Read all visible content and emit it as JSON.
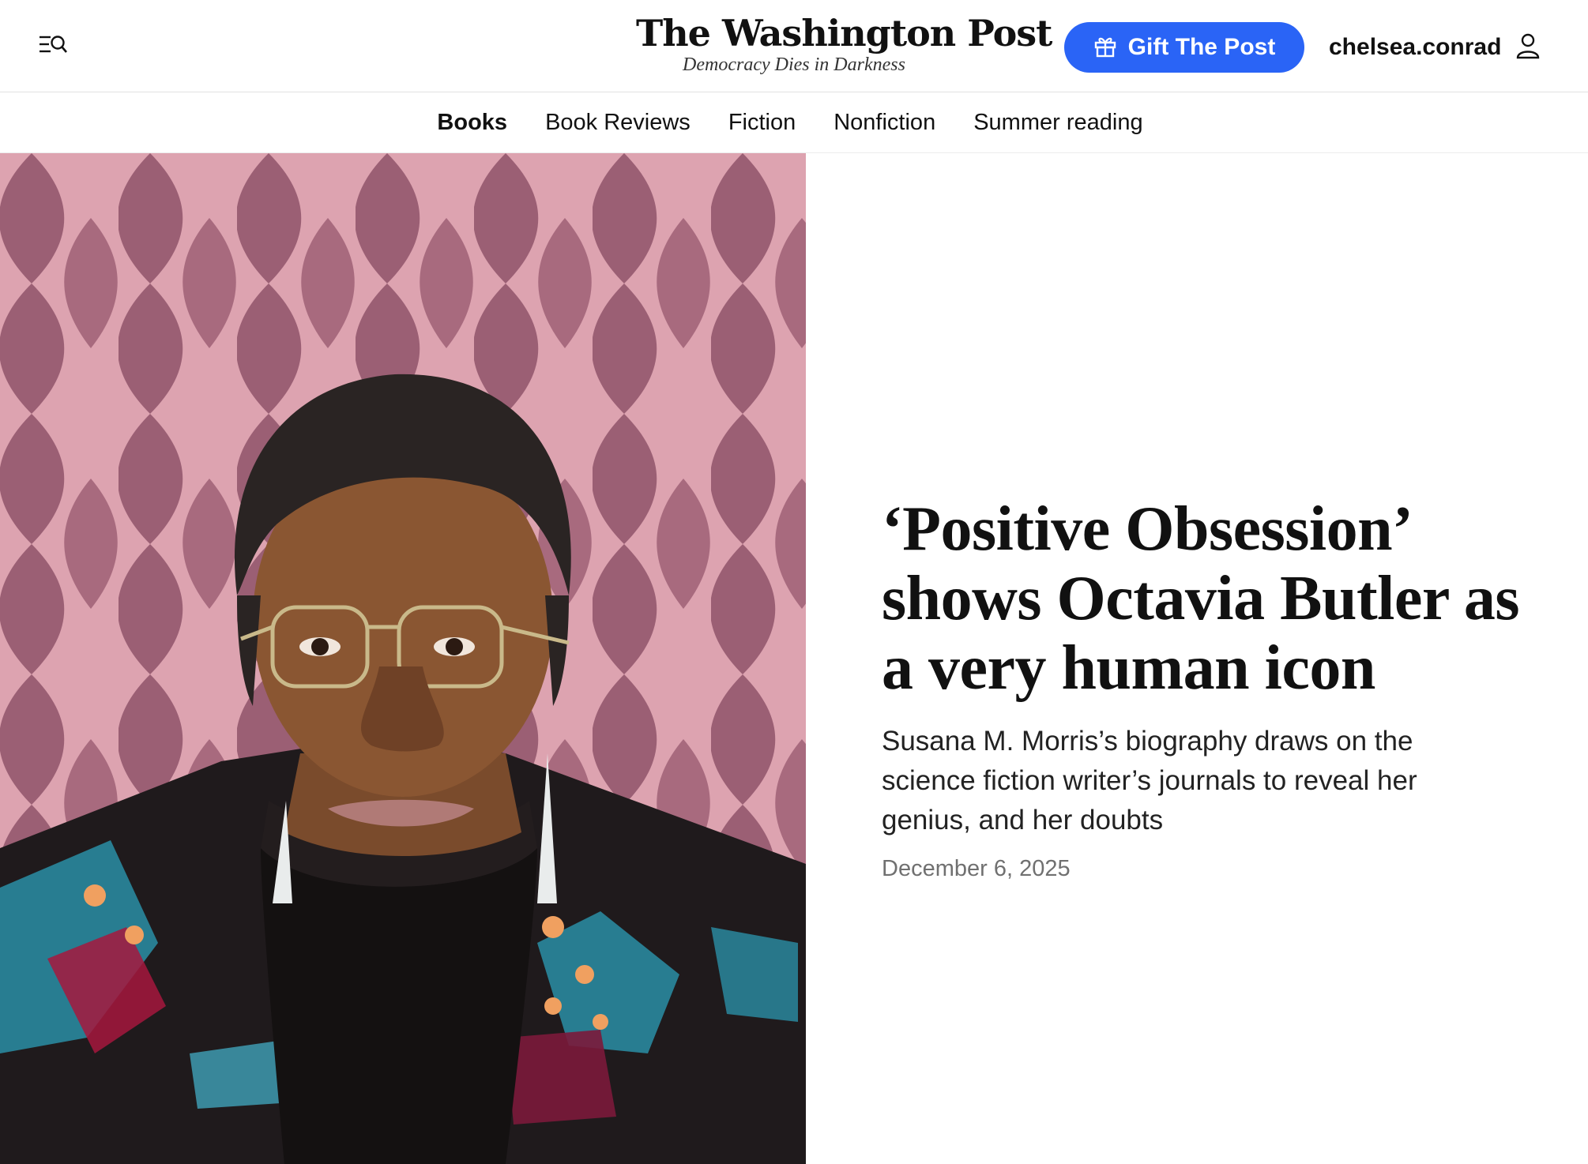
{
  "header": {
    "logo_name": "The Washington Post",
    "logo_tagline": "Democracy Dies in Darkness",
    "gift_label": "Gift The Post",
    "username": "chelsea.conrad",
    "accent_color": "#2a64f6"
  },
  "section_nav": {
    "items": [
      {
        "label": "Books",
        "active": true
      },
      {
        "label": "Book Reviews",
        "active": false
      },
      {
        "label": "Fiction",
        "active": false
      },
      {
        "label": "Nonfiction",
        "active": false
      },
      {
        "label": "Summer reading",
        "active": false
      }
    ]
  },
  "article": {
    "headline": "‘Positive Obsession’ shows Octavia Butler as a very human icon",
    "dek": "Susana M. Morris’s biography draws on the science fiction writer’s journals to reveal her genius, and her doubts",
    "date": "December 6, 2025"
  },
  "icons": {
    "menu": "menu-search-icon",
    "gift": "gift-icon",
    "user": "user-icon"
  }
}
